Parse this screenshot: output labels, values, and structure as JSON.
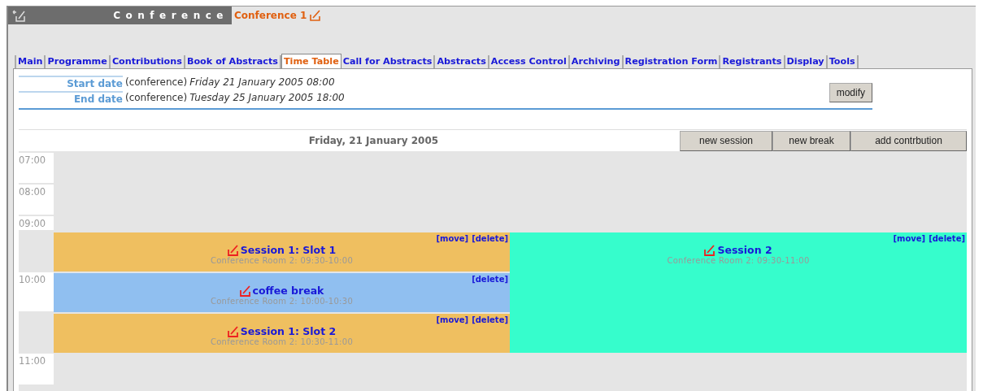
{
  "header": {
    "section": "Conference",
    "title": "Conference 1"
  },
  "tabs": [
    {
      "label": "Main",
      "selected": false
    },
    {
      "label": "Programme",
      "selected": false
    },
    {
      "label": "Contributions",
      "selected": false
    },
    {
      "label": "Book of Abstracts",
      "selected": false
    },
    {
      "label": "Time Table",
      "selected": true
    },
    {
      "label": "Call for Abstracts",
      "selected": false
    },
    {
      "label": "Abstracts",
      "selected": false
    },
    {
      "label": "Access Control",
      "selected": false
    },
    {
      "label": "Archiving",
      "selected": false
    },
    {
      "label": "Registration Form",
      "selected": false
    },
    {
      "label": "Registrants",
      "selected": false
    },
    {
      "label": "Display",
      "selected": false
    },
    {
      "label": "Tools",
      "selected": false
    }
  ],
  "dates": [
    {
      "label": "Start date",
      "source": "(conference)",
      "value": "Friday 21 January 2005 08:00"
    },
    {
      "label": "End date",
      "source": "(conference)",
      "value": "Tuesday 25 January 2005 18:00"
    }
  ],
  "modify_button": "modify",
  "timetable": {
    "day": "Friday, 21 January 2005",
    "buttons": [
      "new session",
      "new break",
      "add contrbution"
    ],
    "hours": [
      "07:00",
      "08:00",
      "09:00",
      "10:00",
      "11:00"
    ],
    "entries": [
      {
        "title": "Session 1: Slot 1",
        "location": "Conference Room 2: 09:30-10:00",
        "actions": [
          "[move]",
          "[delete]"
        ],
        "color": "#efbf60"
      },
      {
        "title": "coffee break",
        "location": "Conference Room 2: 10:00-10:30",
        "actions": [
          "[delete]"
        ],
        "color": "#90bff0"
      },
      {
        "title": "Session 1: Slot 2",
        "location": "Conference Room 2: 10:30-11:00",
        "actions": [
          "[move]",
          "[delete]"
        ],
        "color": "#efbf60"
      },
      {
        "title": "Session 2",
        "location": "Conference Room 2: 09:30-11:00",
        "actions": [
          "[move]",
          "[delete]"
        ],
        "color": "#36fdcc"
      }
    ]
  }
}
